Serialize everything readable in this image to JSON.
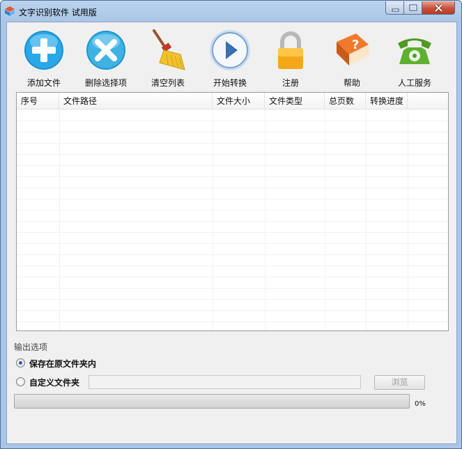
{
  "window": {
    "title": "文字识别软件 试用版",
    "controls": {
      "minimize": "minimize-icon",
      "maximize": "maximize-icon",
      "close": "close-icon"
    }
  },
  "toolbar": {
    "items": [
      {
        "label": "添加文件",
        "icon": "add-plus-icon"
      },
      {
        "label": "删除选择项",
        "icon": "delete-x-icon"
      },
      {
        "label": "清空列表",
        "icon": "broom-icon"
      },
      {
        "label": "开始转换",
        "icon": "play-icon"
      },
      {
        "label": "注册",
        "icon": "lock-icon"
      },
      {
        "label": "帮助",
        "icon": "help-book-icon"
      },
      {
        "label": "人工服务",
        "icon": "telephone-icon"
      }
    ]
  },
  "file_list": {
    "columns": [
      "序号",
      "文件路径",
      "文件大小",
      "文件类型",
      "总页数",
      "转换进度"
    ],
    "rows": []
  },
  "output": {
    "section_label": "输出选项",
    "option_source_folder": "保存在原文件夹内",
    "option_custom_folder": "自定义文件夹",
    "selected": "保存在原文件夹内",
    "custom_path_value": "",
    "browse_label": "浏览"
  },
  "progress": {
    "value": 0,
    "text": "0%"
  },
  "colors": {
    "titlebar": "#a9c6e8",
    "client_bg": "#f0f0f0",
    "add_icon": "#1e9ad6",
    "delete_icon": "#2aa5d8",
    "lock_icon": "#f0a81c",
    "phone_icon": "#5aa02c"
  }
}
